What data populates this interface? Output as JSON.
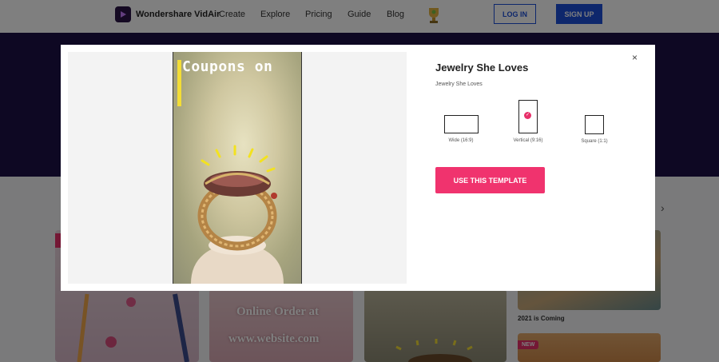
{
  "nav": {
    "brand": "Wondershare VidAir",
    "links": [
      "Create",
      "Explore",
      "Pricing",
      "Guide",
      "Blog"
    ],
    "login_label": "LOG IN",
    "signup_label": "SIGN UP"
  },
  "background": {
    "card2_line1": "Online Order at",
    "card2_line2": "www.website.com",
    "card4_caption": "2021 is Coming",
    "new_badge": "NEW"
  },
  "modal": {
    "title": "Jewelry She Loves",
    "subtitle": "Jewelry She Loves",
    "close_icon": "×",
    "preview_text": "Coupons on",
    "ratios": [
      {
        "label": "Wide (16:9)",
        "selected": false
      },
      {
        "label": "Vertical (9:16)",
        "selected": true
      },
      {
        "label": "Square (1:1)",
        "selected": false
      }
    ],
    "use_template_label": "USE THIS TEMPLATE",
    "accent_color": "#f0336e"
  }
}
